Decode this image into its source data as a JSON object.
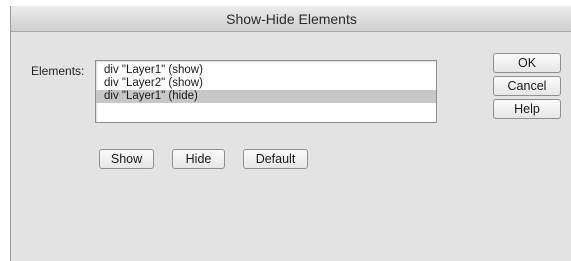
{
  "dialog": {
    "title": "Show-Hide Elements",
    "elements_label": "Elements:",
    "elements_list": [
      {
        "label": "div \"Layer1\" (show)",
        "selected": false
      },
      {
        "label": "div \"Layer2\" (show)",
        "selected": false
      },
      {
        "label": "div \"Layer1\" (hide)",
        "selected": true
      }
    ],
    "buttons": {
      "ok": "OK",
      "cancel": "Cancel",
      "help": "Help",
      "show": "Show",
      "hide": "Hide",
      "default": "Default"
    }
  },
  "colors": {
    "dialog_background": "#e3e3e3",
    "selection_highlight": "#c7c7c7"
  }
}
